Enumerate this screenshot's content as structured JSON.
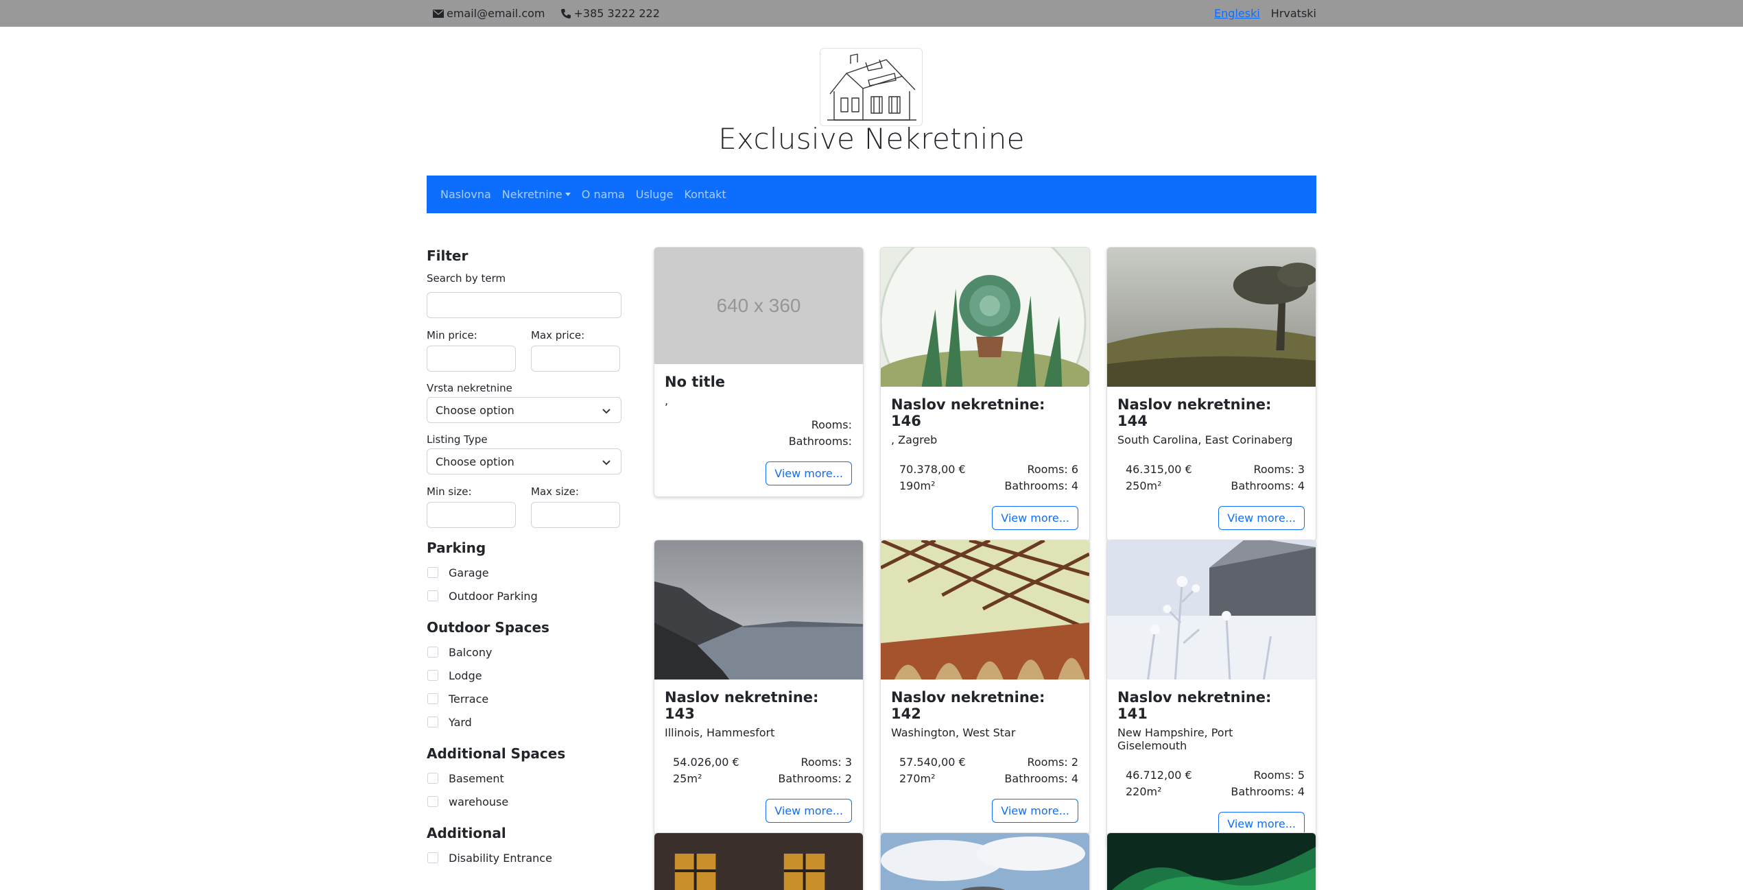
{
  "topbar": {
    "email": "email@email.com",
    "phone": "+385 3222 222",
    "languages": [
      "Engleski",
      "Hrvatski"
    ]
  },
  "header": {
    "brand": "Exclusive Nekretnine"
  },
  "nav": [
    "Naslovna",
    "Nekretnine",
    "O nama",
    "Usluge",
    "Kontakt"
  ],
  "filter": {
    "title": "Filter",
    "search_label": "Search by term",
    "min_price_label": "Min price:",
    "max_price_label": "Max price:",
    "property_type_label": "Vrsta nekretnine",
    "property_type_value": "Choose option",
    "listing_type_label": "Listing Type",
    "listing_type_value": "Choose option",
    "min_size_label": "Min size:",
    "max_size_label": "Max size:",
    "sections": [
      {
        "title": "Parking",
        "options": [
          "Garage",
          "Outdoor Parking"
        ]
      },
      {
        "title": "Outdoor Spaces",
        "options": [
          "Balcony",
          "Lodge",
          "Terrace",
          "Yard"
        ]
      },
      {
        "title": "Additional Spaces",
        "options": [
          "Basement",
          "warehouse"
        ]
      },
      {
        "title": "Additional",
        "options": [
          "Disability Entrance"
        ]
      }
    ]
  },
  "cards": [
    {
      "title": "No title",
      "location": ",",
      "price": "",
      "size": "",
      "rooms": "Rooms:",
      "bathrooms": "Bathrooms:",
      "button": "View more...",
      "image": "placeholder",
      "placeholder_text": "640 x 360"
    },
    {
      "title": "Naslov nekretnine: 146",
      "location": ", Zagreb",
      "price": "70.378,00 €",
      "size": "190m²",
      "rooms": "Rooms: 6",
      "bathrooms": "Bathrooms: 4",
      "button": "View more...",
      "image": "succulent-terrarium-photo"
    },
    {
      "title": "Naslov nekretnine: 144",
      "location": "South Carolina, East Corinaberg",
      "price": "46.315,00 €",
      "size": "250m²",
      "rooms": "Rooms: 3",
      "bathrooms": "Bathrooms: 4",
      "button": "View more...",
      "image": "foggy-tree-photo"
    },
    {
      "title": "Naslov nekretnine: 143",
      "location": "Illinois, Hammesfort",
      "price": "54.026,00 €",
      "size": "25m²",
      "rooms": "Rooms: 3",
      "bathrooms": "Bathrooms: 2",
      "button": "View more...",
      "image": "coastline-photo"
    },
    {
      "title": "Naslov nekretnine: 142",
      "location": "Washington, West Star",
      "price": "57.540,00 €",
      "size": "270m²",
      "rooms": "Rooms: 2",
      "bathrooms": "Bathrooms: 4",
      "button": "View more...",
      "image": "bridge-photo"
    },
    {
      "title": "Naslov nekretnine: 141",
      "location": "New Hampshire, Port Giselemouth",
      "price": "46.712,00 €",
      "size": "220m²",
      "rooms": "Rooms: 5",
      "bathrooms": "Bathrooms: 4",
      "button": "View more...",
      "image": "frosty-plants-photo"
    }
  ],
  "colors": {
    "topbar": "#999999",
    "nav": "#0d6efd",
    "accent": "#0d6efd"
  }
}
